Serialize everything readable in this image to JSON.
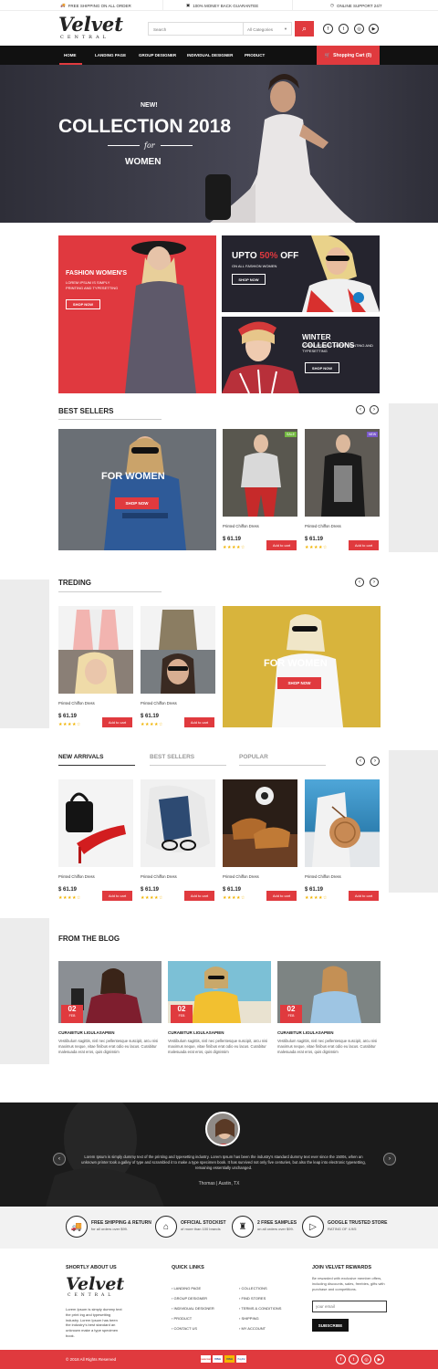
{
  "topbar": {
    "shipping": "FREE SHIPPING ON ALL ORDER",
    "guarantee": "100% MONEY BACK GUARANTEE",
    "support": "ONLINE SUPPORT 24/7"
  },
  "brand": {
    "name": "Velvet",
    "sub": "CENTRAL"
  },
  "search": {
    "placeholder": "Search",
    "category": "All Categories"
  },
  "social": [
    "facebook-icon",
    "twitter-icon",
    "instagram-icon",
    "youtube-icon"
  ],
  "nav": {
    "items": [
      "HOME",
      "LANDING PAGE",
      "GROUP DESIGNER",
      "INDIVIDUAL DESIGNER",
      "PRODUCT"
    ],
    "cart": "Shopping Cart (0)"
  },
  "hero": {
    "new": "NEW!",
    "title": "COLLECTION 2018",
    "for": "for",
    "sub": "WOMEN"
  },
  "promos": {
    "fashion": {
      "title": "FASHION WOMEN'S",
      "text": "LOREM IPSUM IS SIMPLY PRINTING AND TYPESETTING",
      "button": "SHOP NOW"
    },
    "upto": {
      "title_pre": "UPTO",
      "title_pct": "50%",
      "title_post": "OFF",
      "text": "ON ALL FASHION WOMEN",
      "button": "SHOP NOW"
    },
    "winter": {
      "title": "WINTER COLLECTIONS",
      "text": "LOREM IPSUM IS SIMPLY PRINTING AND TYPESETTING",
      "button": "SHOP NOW"
    }
  },
  "bestsellers": {
    "title": "BEST SELLERS",
    "banner": {
      "title": "FOR WOMEN",
      "button": "SHOP NOW"
    },
    "products": [
      {
        "name": "Printed Chiffon Dress",
        "price": "$ 61.19",
        "stars": "★★★★☆",
        "badge": "SALE",
        "button": "Add to cart"
      },
      {
        "name": "Printed Chiffon Dress",
        "price": "$ 61.19",
        "stars": "★★★★☆",
        "badge": "NEW",
        "button": "Add to cart"
      }
    ]
  },
  "trending": {
    "title": "TREDING",
    "banner": {
      "title": "FOR WOMEN",
      "button": "SHOP NOW"
    },
    "products": [
      {
        "name": "Printed Chiffon Dress",
        "price": "$ 61.19",
        "stars": "★★★★☆",
        "button": "Add to cart"
      },
      {
        "name": "Printed Chiffon Dress",
        "price": "$ 61.19",
        "stars": "★★★★☆",
        "button": "Add to cart"
      }
    ]
  },
  "arrivals": {
    "tabs": [
      "NEW ARRIVALS",
      "BEST SELLERS",
      "POPULAR"
    ],
    "products": [
      {
        "name": "Printed Chiffon Dress",
        "price": "$ 61.19",
        "stars": "★★★★☆",
        "button": "Add to cart"
      },
      {
        "name": "Printed Chiffon Dress",
        "price": "$ 61.19",
        "stars": "★★★★☆",
        "button": "Add to cart"
      },
      {
        "name": "Printed Chiffon Dress",
        "price": "$ 61.19",
        "stars": "★★★★☆",
        "button": "Add to cart"
      },
      {
        "name": "Printed Chiffon Dress",
        "price": "$ 61.19",
        "stars": "★★★★☆",
        "button": "Add to cart"
      }
    ]
  },
  "blog": {
    "title": "FROM THE BLOG",
    "posts": [
      {
        "day": "02",
        "month": "FEB",
        "title": "CURABITUR LIGULASAPIEN",
        "text": "Vestibulum sagittis, nisl nec pellentesque suscipit, arcu nisi maximus neque, vitae finibus erat odio eu lacus. Curabitur malesuada erat eros, quis dignissim"
      },
      {
        "day": "02",
        "month": "FEB",
        "title": "CURABITUR LIGULASAPIEN",
        "text": "Vestibulum sagittis, nisl nec pellentesque suscipit, arcu nisi maximus neque, vitae finibus erat odio eu lacus. Curabitur malesuada erat eros, quis dignissim"
      },
      {
        "day": "02",
        "month": "FEB",
        "title": "CURABITUR LIGULASAPIEN",
        "text": "Vestibulum sagittis, nisl nec pellentesque suscipit, arcu nisi maximus neque, vitae finibus erat odio eu lacus. Curabitur malesuada erat eros, quis dignissim"
      }
    ]
  },
  "testimonial": {
    "text": "Lorem Ipsum is simply dummy text of the printing and typesetting industry. Lorem Ipsum has been the industry's standard dummy text ever since the 1500s, when an unknown printer took a galley of type and scrambled it to make a type specimen book. It has survived not only five centuries, but also the leap into electronic typesetting, remaining essentially unchanged.",
    "author": "Thomas | Austin, TX"
  },
  "features": [
    {
      "icon": "truck-icon",
      "title": "FREE SHIPPING & RETURN",
      "sub": "for all orders over $99."
    },
    {
      "icon": "store-icon",
      "title": "OFFICIAL STOCKIST",
      "sub": "of more than 100 brands"
    },
    {
      "icon": "dress-icon",
      "title": "2 FREE SAMPLES",
      "sub": "on all orders over $99."
    },
    {
      "icon": "play-icon",
      "title": "GOOGLE TRUSTED STORE",
      "sub": "RATING OF 4.9/5"
    }
  ],
  "footer": {
    "about": {
      "title": "SHORTLY ABOUT US",
      "text": "Lorem Ipsum is simply dummy text the print ing and typesetting industry. Lorem Ipsum has been the industry's best standard an unknown make a type specimen book."
    },
    "links": {
      "title": "QUICK LINKS",
      "col1": [
        "LANDING PAGE",
        "GROUP DESIGNER",
        "INDIVIDUAL DESIGNER",
        "PRODUCT",
        "CONTACT US"
      ],
      "col2": [
        "COLLECTIONS",
        "FIND STORES",
        "TERMS & CONDITIONS",
        "SHIPPING",
        "MY ACCOUNT"
      ]
    },
    "rewards": {
      "title": "JOIN VELVET REWARDS",
      "text": "Be rewarded with exclusive member offers, including discounts, sales, freebies, gifts with purchase and competitions.",
      "placeholder": "your email",
      "button": "SUBSCRIBE"
    },
    "copyright": "© 2018 All Rights Reserved",
    "payments": [
      "mastercard",
      "VISA",
      "VISA",
      "PayPal"
    ]
  }
}
